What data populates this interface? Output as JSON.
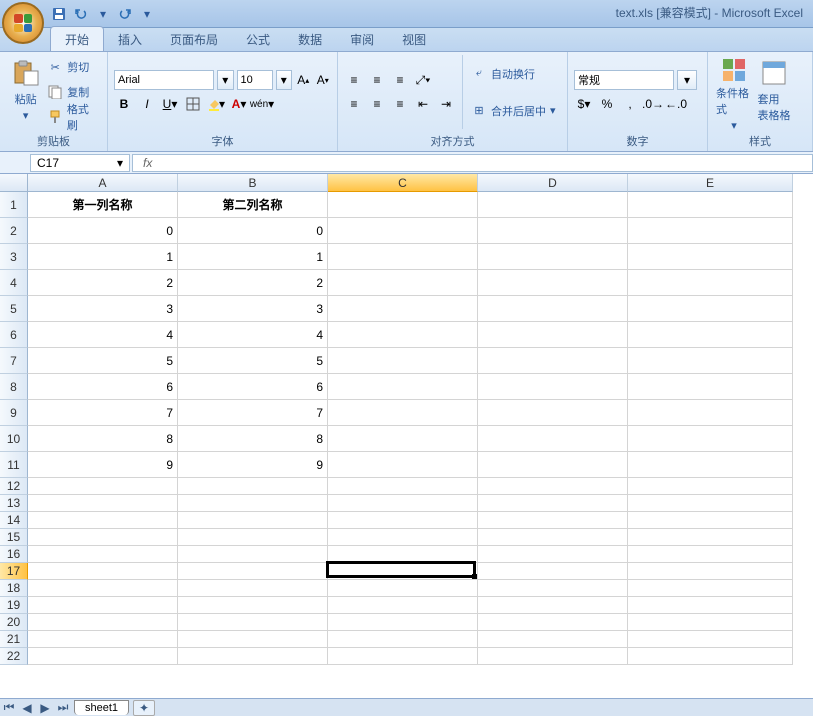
{
  "title_suffix": "text.xls  [兼容模式] - Microsoft Excel",
  "tabs": [
    "开始",
    "插入",
    "页面布局",
    "公式",
    "数据",
    "审阅",
    "视图"
  ],
  "active_tab": 0,
  "clipboard": {
    "paste": "粘贴",
    "cut": "剪切",
    "copy": "复制",
    "format_painter": "格式刷",
    "label": "剪贴板"
  },
  "font": {
    "name": "Arial",
    "size": "10",
    "label": "字体"
  },
  "alignment": {
    "wrap": "自动换行",
    "merge": "合并后居中",
    "label": "对齐方式"
  },
  "number": {
    "format": "常规",
    "label": "数字"
  },
  "style": {
    "cond": "条件格式",
    "table": "套用\n表格格",
    "label": "样式"
  },
  "namebox": "C17",
  "formula": "",
  "columns": [
    {
      "id": "A",
      "width": 150
    },
    {
      "id": "B",
      "width": 150
    },
    {
      "id": "C",
      "width": 150
    },
    {
      "id": "D",
      "width": 150
    },
    {
      "id": "E",
      "width": 165
    }
  ],
  "active_col": "C",
  "active_row": 17,
  "header_cells": {
    "A": "第一列名称",
    "B": "第二列名称"
  },
  "data_rows": [
    {
      "A": "0",
      "B": "0"
    },
    {
      "A": "1",
      "B": "1"
    },
    {
      "A": "2",
      "B": "2"
    },
    {
      "A": "3",
      "B": "3"
    },
    {
      "A": "4",
      "B": "4"
    },
    {
      "A": "5",
      "B": "5"
    },
    {
      "A": "6",
      "B": "6"
    },
    {
      "A": "7",
      "B": "7"
    },
    {
      "A": "8",
      "B": "8"
    },
    {
      "A": "9",
      "B": "9"
    }
  ],
  "total_rows": 22,
  "sheet_name": "sheet1"
}
